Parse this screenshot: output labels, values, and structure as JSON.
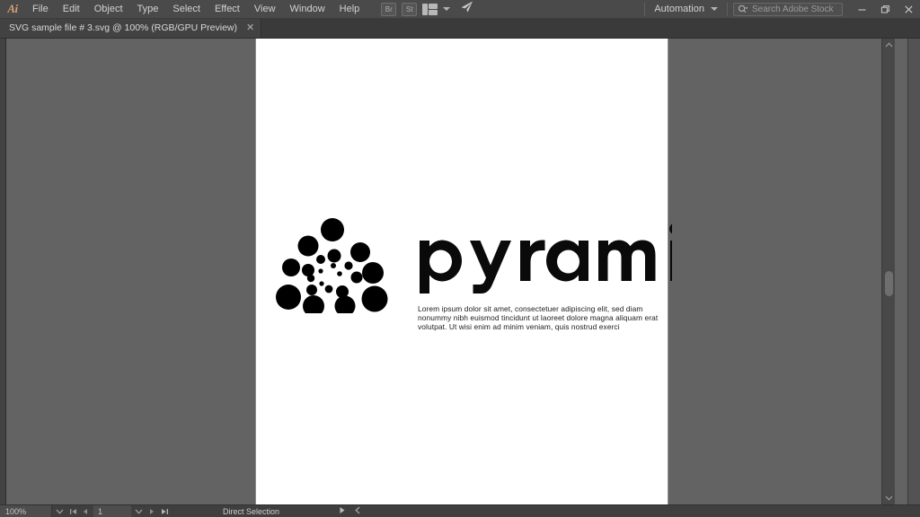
{
  "app": {
    "name": "Adobe Illustrator",
    "logo_text": "Ai"
  },
  "menubar": {
    "items": [
      {
        "label": "File"
      },
      {
        "label": "Edit"
      },
      {
        "label": "Object"
      },
      {
        "label": "Type"
      },
      {
        "label": "Select"
      },
      {
        "label": "Effect"
      },
      {
        "label": "View"
      },
      {
        "label": "Window"
      },
      {
        "label": "Help"
      }
    ],
    "bridge_label": "Br",
    "stock_label": "St",
    "automation_label": "Automation",
    "search": {
      "placeholder": "Search Adobe Stock",
      "value": ""
    },
    "window_controls": {
      "minimize": "—",
      "restore": "❐",
      "close": "✕"
    }
  },
  "tabs": [
    {
      "title": "SVG sample file # 3.svg @ 100% (RGB/GPU Preview)",
      "close_label": "✕",
      "active": true
    }
  ],
  "document": {
    "artwork": {
      "wordmark_text": "pyramid",
      "body_text": "Lorem ipsum dolor sit amet, consectetuer adipiscing elit, sed diam nonummy nibh euismod tincidunt ut laoreet dolore magna aliquam erat volutpat. Ut wisi enim ad minim veniam, quis nostrud exerci",
      "artwork_color": "#000000",
      "background_color": "#ffffff"
    }
  },
  "statusbar": {
    "zoom_value": "100%",
    "page_value": "1",
    "tool_label": "Direct Selection",
    "first_page_icon": "⏮",
    "prev_page_icon": "◀",
    "next_page_icon": "▶",
    "last_page_icon": "⏭",
    "play_icon": "▶",
    "back_icon": "‹"
  },
  "theme": {
    "menubar_bg": "#4a4a4a",
    "tabbar_bg": "#3a3a3a",
    "canvas_bg": "#636363",
    "statusbar_bg": "#3f3f3f",
    "accent": "#d8a070"
  }
}
